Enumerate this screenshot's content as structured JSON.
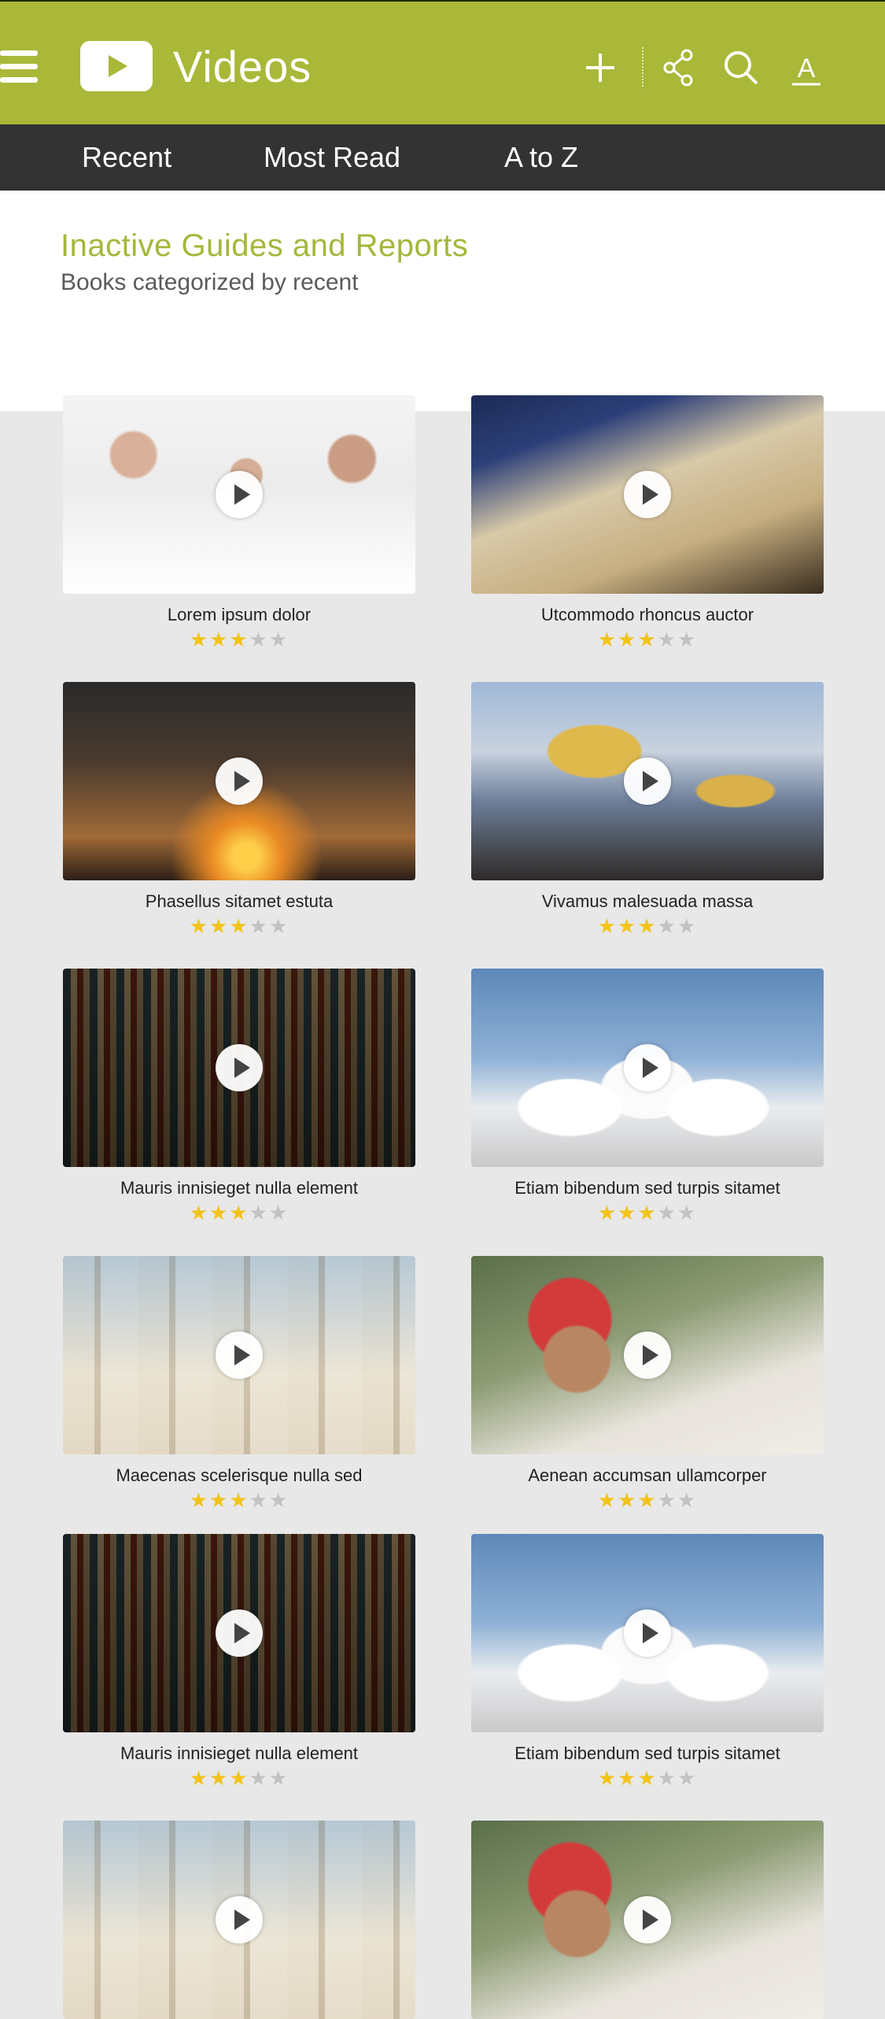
{
  "app": {
    "title": "Videos",
    "accent": "#a9b838",
    "tabbar_color": "#333333"
  },
  "toolbar": {
    "menu_icon": "hamburger-menu-icon",
    "logo_icon": "play-logo-icon",
    "actions": [
      {
        "name": "add-icon"
      },
      {
        "name": "share-icon"
      },
      {
        "name": "search-icon"
      },
      {
        "name": "font-size-icon",
        "label": "A"
      }
    ]
  },
  "tabs": [
    {
      "label": "Recent",
      "selected": true
    },
    {
      "label": "Most Read",
      "selected": false
    },
    {
      "label": "A to Z",
      "selected": false
    }
  ],
  "section": {
    "title": "Inactive Guides and Reports",
    "subtitle": "Books categorized by recent",
    "title_color": "#a6b63b"
  },
  "videos": [
    {
      "title": "Lorem ipsum dolor",
      "rating": 3,
      "max_rating": 5,
      "image": "people"
    },
    {
      "title": "Utcommodo rhoncus auctor",
      "rating": 3,
      "max_rating": 5,
      "image": "mosque1"
    },
    {
      "title": "Phasellus sitamet estuta",
      "rating": 3,
      "max_rating": 5,
      "image": "sunset"
    },
    {
      "title": "Vivamus malesuada massa",
      "rating": 3,
      "max_rating": 5,
      "image": "shrine"
    },
    {
      "title": "Mauris innisieget nulla element",
      "rating": 3,
      "max_rating": 5,
      "image": "prayer"
    },
    {
      "title": "Etiam bibendum sed turpis sitamet",
      "rating": 3,
      "max_rating": 5,
      "image": "whitemosque"
    },
    {
      "title": "Maecenas scelerisque nulla sed",
      "rating": 3,
      "max_rating": 5,
      "image": "columns"
    },
    {
      "title": "Aenean accumsan ullamcorper",
      "rating": 3,
      "max_rating": 5,
      "image": "portrait"
    },
    {
      "title": "Mauris innisieget nulla element",
      "rating": 3,
      "max_rating": 5,
      "image": "prayer"
    },
    {
      "title": "Etiam bibendum sed turpis sitamet",
      "rating": 3,
      "max_rating": 5,
      "image": "whitemosque"
    },
    {
      "title": "",
      "rating": 0,
      "max_rating": 0,
      "image": "columns"
    },
    {
      "title": "",
      "rating": 0,
      "max_rating": 0,
      "image": "portrait"
    }
  ]
}
